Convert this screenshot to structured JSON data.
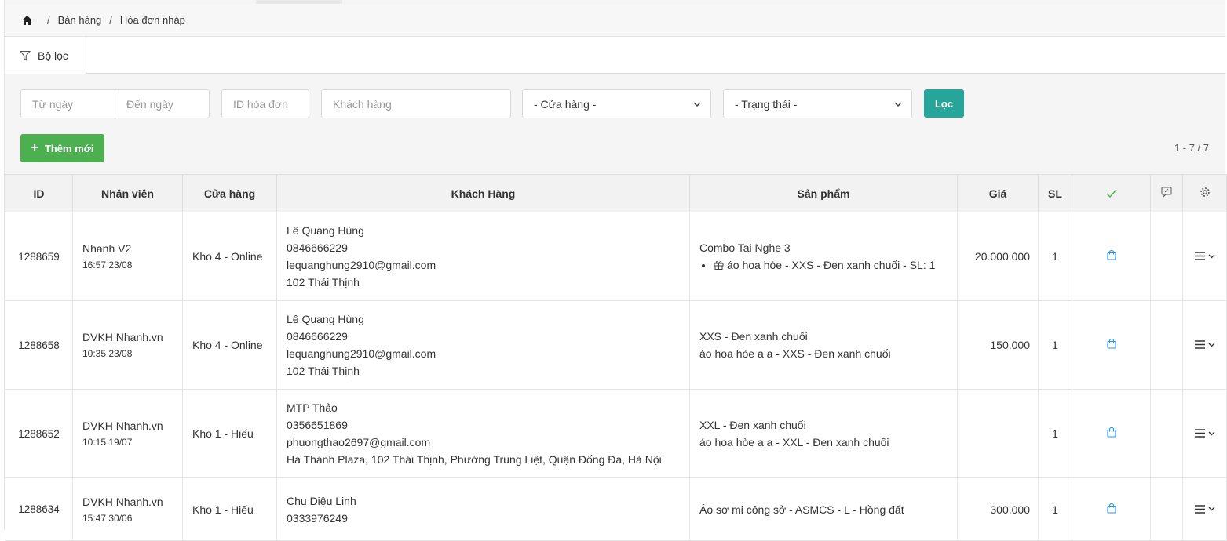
{
  "breadcrumb": {
    "home_icon": "home-icon",
    "items": [
      "Bán hàng",
      "Hóa đơn nháp"
    ]
  },
  "tabs": {
    "active_label": "Bộ lọc"
  },
  "filters": {
    "from_date_placeholder": "Từ ngày",
    "to_date_placeholder": "Đến ngày",
    "invoice_id_placeholder": "ID hóa đơn",
    "customer_placeholder": "Khách hàng",
    "store_selected": "- Cửa hàng -",
    "status_selected": "- Trạng thái -",
    "filter_button": "Lọc"
  },
  "actions": {
    "add_label": "Thêm mới",
    "pagination": "1 - 7 / 7"
  },
  "colors": {
    "filter_button": "#26a69a",
    "add_button": "#4caf50",
    "check_icon": "#4caf50",
    "bag_icon": "#2196f3"
  },
  "table": {
    "headers": [
      "ID",
      "Nhân viên",
      "Cửa hàng",
      "Khách Hàng",
      "Sản phẩm",
      "Giá",
      "SL"
    ],
    "header_icons": [
      "check-icon",
      "chat-icon",
      "gear-icon"
    ],
    "rows": [
      {
        "id": "1288659",
        "staff": "Nhanh V2",
        "time": "16:57 23/08",
        "store": "Kho 4 - Online",
        "customer": [
          "Lê Quang Hùng",
          "0846666229",
          "lequanghung2910@gmail.com",
          "102 Thái Thịnh"
        ],
        "product_title": "Combo Tai Nghe 3",
        "product_lines": [],
        "product_bullets": [
          "áo hoa hòe - XXS - Đen xanh chuối - SL: 1"
        ],
        "price": "20.000.000",
        "qty": "1"
      },
      {
        "id": "1288658",
        "staff": "DVKH Nhanh.vn",
        "time": "10:35 23/08",
        "store": "Kho 4 - Online",
        "customer": [
          "Lê Quang Hùng",
          "0846666229",
          "lequanghung2910@gmail.com",
          "102 Thái Thịnh"
        ],
        "product_title": "",
        "product_lines": [
          "XXS - Đen xanh chuối",
          "áo hoa hòe a a - XXS - Đen xanh chuối"
        ],
        "product_bullets": [],
        "price": "150.000",
        "qty": "1"
      },
      {
        "id": "1288652",
        "staff": "DVKH Nhanh.vn",
        "time": "10:15 19/07",
        "store": "Kho 1 - Hiếu",
        "customer": [
          "MTP Thảo",
          "0356651869",
          "phuongthao2697@gmail.com",
          "Hà Thành Plaza, 102 Thái Thịnh, Phường Trung Liệt, Quận Đống Đa, Hà Nội"
        ],
        "product_title": "",
        "product_lines": [
          "XXL - Đen xanh chuối",
          "áo hoa hòe a a - XXL - Đen xanh chuối"
        ],
        "product_bullets": [],
        "price": "",
        "qty": "1"
      },
      {
        "id": "1288634",
        "staff": "DVKH Nhanh.vn",
        "time": "15:47 30/06",
        "store": "Kho 1 - Hiếu",
        "customer": [
          "Chu Diệu Linh",
          "0333976249"
        ],
        "product_title": "",
        "product_lines": [
          "Áo sơ mi công sở - ASMCS - L - Hồng đất"
        ],
        "product_bullets": [],
        "price": "300.000",
        "qty": "1"
      }
    ]
  }
}
